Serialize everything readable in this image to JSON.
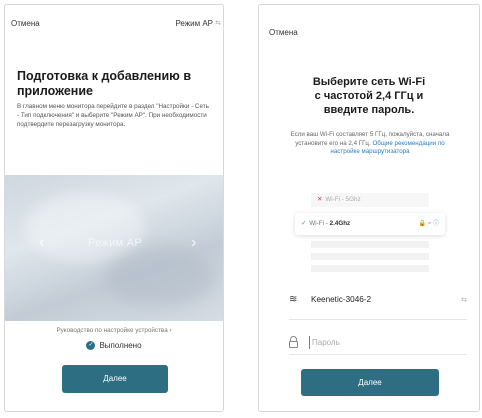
{
  "left_screen": {
    "cancel": "Отмена",
    "mode": "Режим AP",
    "mode_icon": "⇆",
    "title": "Подготовка к добавлению в приложение",
    "description": "В главном меню монитора перейдите в раздел \"Настройки - Сеть - Тип подключения\" и выберите \"Режим АР\". При необходимости подтвердите перезагрузку монитора.",
    "banner_text": "Режим AP",
    "arrow_left": "‹",
    "arrow_right": "›",
    "guide_link": "Руководство по настройке устройства ›",
    "done_icon": "✓",
    "done_label": "Выполнено",
    "next_button": "Далее"
  },
  "right_screen": {
    "cancel": "Отмена",
    "title_line1": "Выберите сеть Wi-Fi",
    "title_line2": "с частотой 2,4 ГГц и",
    "title_line3": "введите пароль.",
    "note": "Если ваш Wi-Fi составляет 5 ГГц, пожалуйста, сначала установите его на 2,4 ГГц.",
    "note_link": "Общие рекомендации по настройке маршрутизатора",
    "wifi_illustration": {
      "row1_mark": "✕",
      "row1_label": "Wi-Fi - 5Ghz",
      "row2_mark": "✓",
      "row2_prefix": "Wi-Fi - ",
      "row2_band": "2.4Ghz",
      "row2_icons": "🔒 ≈",
      "row2_info": "ⓘ"
    },
    "network_icon": "≋",
    "network_name": "Keenetic-3046-2",
    "switch_icon": "⇆",
    "password_placeholder": "Пароль",
    "next_button": "Далее"
  },
  "colors": {
    "button": "#2e6e82",
    "link": "#2a7ec7",
    "check": "#2bb673",
    "error": "#dd4444"
  }
}
